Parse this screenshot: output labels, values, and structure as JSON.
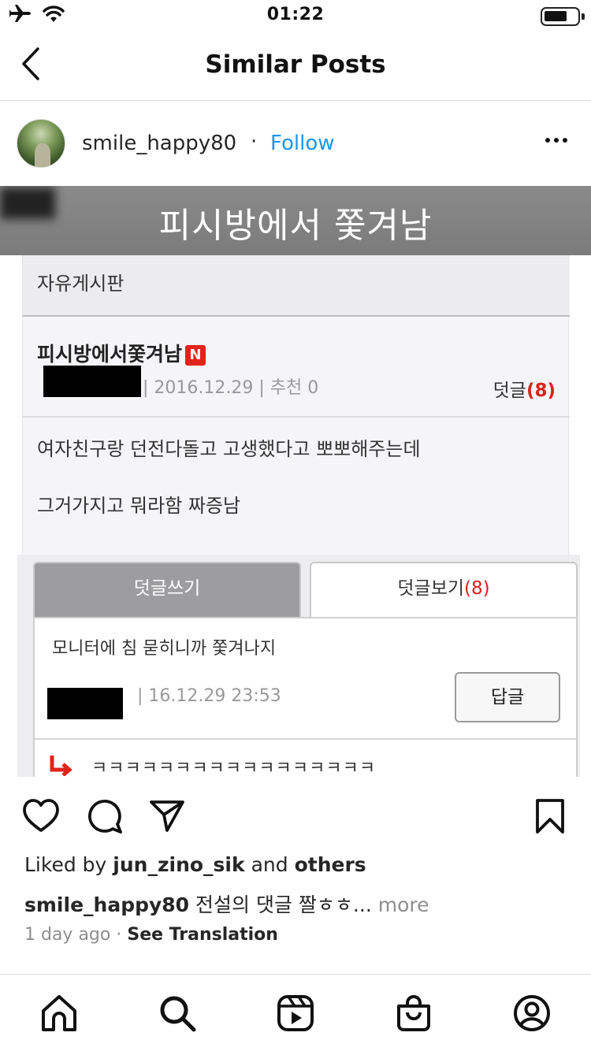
{
  "status_bar": {
    "time": "01:22",
    "icons": [
      "airplane-icon",
      "wifi-icon",
      "battery-icon"
    ]
  },
  "nav": {
    "title": "Similar Posts",
    "back_icon": "chevron-left-icon"
  },
  "post": {
    "username": "smile_happy80",
    "separator": "·",
    "follow_label": "Follow",
    "more_icon": "ellipsis-icon",
    "image": {
      "banner_text": "피시방에서 쫓겨남",
      "board_category": "자유게시판",
      "post_title": "피시방에서쫓겨남",
      "new_badge": "N",
      "meta": "| 2016.12.29 | 추천 0",
      "reply_label": "덧글",
      "reply_count": "(8)",
      "body_lines": [
        "여자친구랑 던전다돌고 고생했다고 뽀뽀해주는데",
        "그거가지고 뭐라함 짜증남"
      ],
      "tab_write": "덧글쓰기",
      "tab_view": "덧글보기",
      "tab_view_count": "(8)",
      "comment_text": "모니터에 침 묻히니까 쫓겨나지",
      "comment_meta": "| 16.12.29 23:53",
      "reply_button": "답글",
      "reply_text": "ㅋㅋㅋㅋㅋㅋㅋㅋㅋㅋㅋㅋㅋㅋㅋㅋㅋ"
    },
    "likes": {
      "prefix": "Liked by ",
      "user": "jun_zino_sik",
      "middle": " and ",
      "others": "others"
    },
    "caption": {
      "user": "smile_happy80",
      "text": " 전설의 댓글 짤ㅎㅎ... ",
      "more": "more"
    },
    "time_ago": "1 day ago",
    "time_sep": " · ",
    "translate": "See Translation"
  },
  "colors": {
    "accent": "#1b95f0",
    "badge_red": "#e2231a",
    "text_primary": "#262626",
    "text_secondary": "#8e8e8e"
  },
  "tab_bar": {
    "items": [
      "home-icon",
      "search-icon",
      "reels-icon",
      "shop-icon",
      "profile-icon"
    ]
  }
}
